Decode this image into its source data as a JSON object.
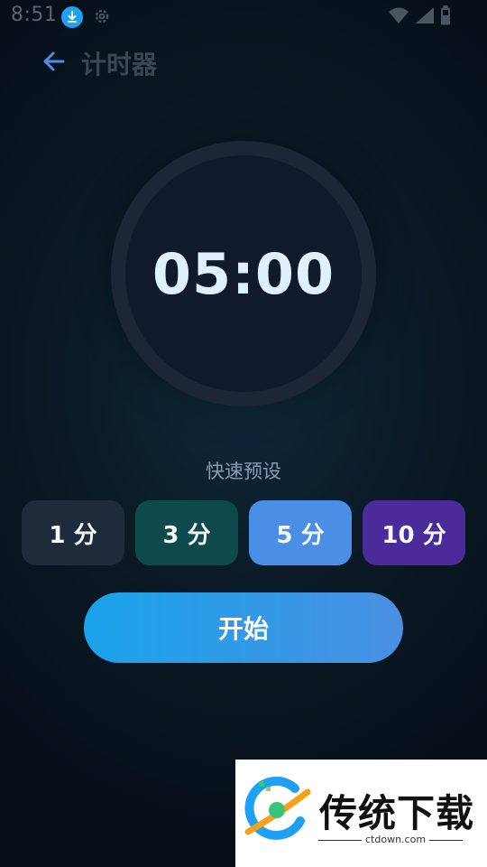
{
  "status_bar": {
    "time": "8:51"
  },
  "header": {
    "title": "计时器"
  },
  "timer": {
    "display": "05:00"
  },
  "presets": {
    "label": "快速预设",
    "items": [
      {
        "label": "1 分",
        "color": "#1f2b3b"
      },
      {
        "label": "3 分",
        "color": "#0e4a4c"
      },
      {
        "label": "5 分",
        "color": "#4a8ee6"
      },
      {
        "label": "10 分",
        "color": "#4b2a9a"
      }
    ]
  },
  "start_button": {
    "label": "开始"
  },
  "watermark": {
    "brand": "传统下载",
    "url": "ctdown.com"
  },
  "colors": {
    "accent": "#4a90e2",
    "start_gradient_from": "#19a3ea",
    "start_gradient_to": "#4a90e2",
    "background": "#0a1a26"
  },
  "icons": {
    "status": [
      "download-icon",
      "gear-icon",
      "wifi-icon",
      "signal-icon",
      "battery-icon"
    ],
    "header": "back-arrow-icon"
  }
}
